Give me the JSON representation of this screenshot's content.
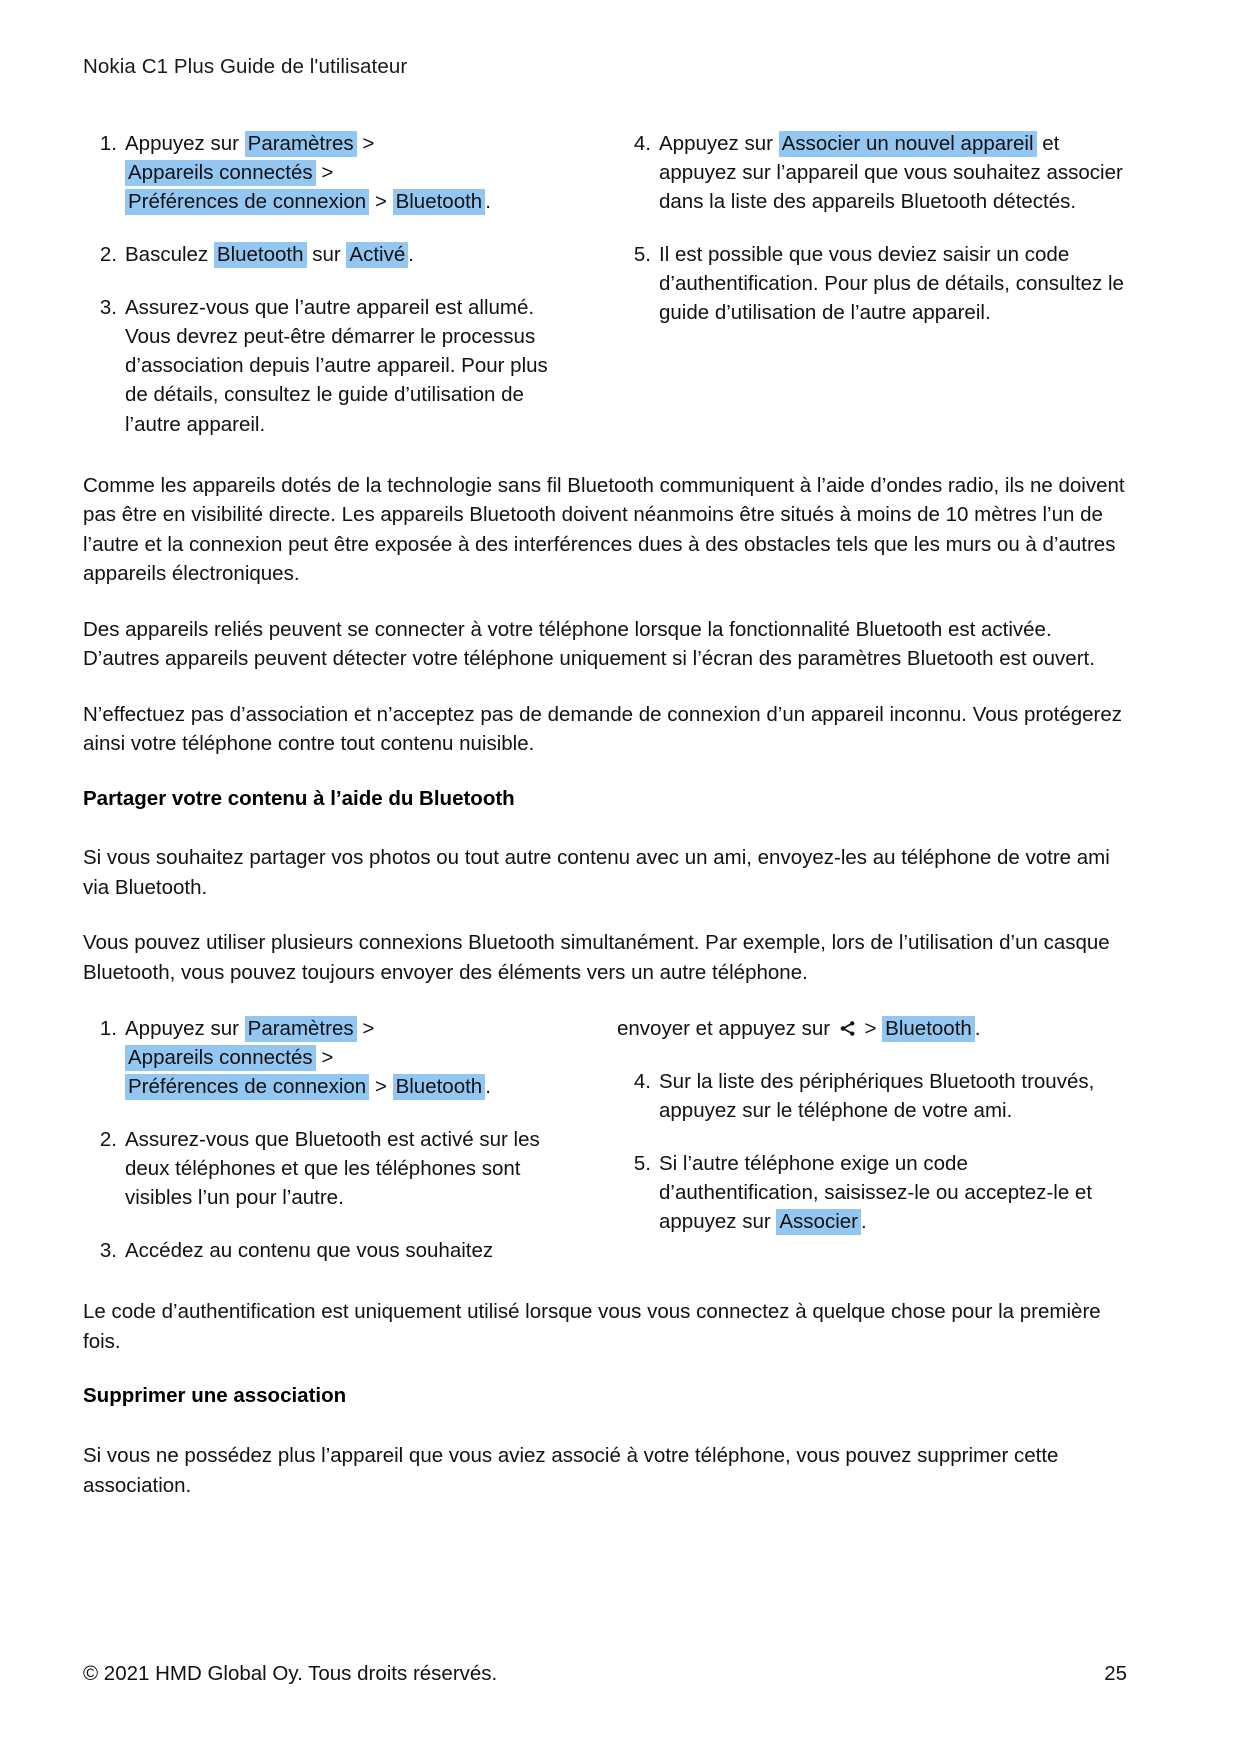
{
  "header": {
    "title": "Nokia C1 Plus Guide de l'utilisateur"
  },
  "section_pairing": {
    "left_steps": [
      {
        "num": "1.",
        "parts": [
          {
            "t": "text",
            "v": "Appuyez sur "
          },
          {
            "t": "hl",
            "v": "Paramètres"
          },
          {
            "t": "text",
            "v": " > "
          },
          {
            "t": "hl",
            "v": "Appareils connectés"
          },
          {
            "t": "text",
            "v": " > "
          },
          {
            "t": "hl",
            "v": "Préférences de connexion"
          },
          {
            "t": "text",
            "v": " > "
          },
          {
            "t": "hl",
            "v": "Bluetooth"
          },
          {
            "t": "text",
            "v": "."
          }
        ]
      },
      {
        "num": "2.",
        "parts": [
          {
            "t": "text",
            "v": "Basculez "
          },
          {
            "t": "hl",
            "v": "Bluetooth"
          },
          {
            "t": "text",
            "v": " sur "
          },
          {
            "t": "hl",
            "v": "Activé"
          },
          {
            "t": "text",
            "v": "."
          }
        ]
      },
      {
        "num": "3.",
        "parts": [
          {
            "t": "text",
            "v": "Assurez-vous que l’autre appareil est allumé. Vous devrez peut-être démarrer le processus d’association depuis l’autre appareil. Pour plus de détails, consultez le guide d’utilisation de l’autre appareil."
          }
        ]
      }
    ],
    "right_steps": [
      {
        "num": "4.",
        "parts": [
          {
            "t": "text",
            "v": "Appuyez sur "
          },
          {
            "t": "hl",
            "v": "Associer un nouvel appareil"
          },
          {
            "t": "text",
            "v": " et appuyez sur l’appareil que vous souhaitez associer dans la liste des appareils Bluetooth détectés."
          }
        ]
      },
      {
        "num": "5.",
        "parts": [
          {
            "t": "text",
            "v": "Il est possible que vous deviez saisir un code d’authentification. Pour plus de détails, consultez le guide d’utilisation de l’autre appareil."
          }
        ]
      }
    ]
  },
  "paragraphs": {
    "p1": "Comme les appareils dotés de la technologie sans fil Bluetooth communiquent à l’aide d’ondes radio, ils ne doivent pas être en visibilité directe. Les appareils Bluetooth doivent néanmoins être situés à moins de 10 mètres l’un de l’autre et la connexion peut être exposée à des interférences dues à des obstacles tels que les murs ou à d’autres appareils électroniques.",
    "p2": "Des appareils reliés peuvent se connecter à votre téléphone lorsque la fonctionnalité Bluetooth est activée. D’autres appareils peuvent détecter votre téléphone uniquement si l’écran des paramètres Bluetooth est ouvert.",
    "p3": "N’effectuez pas d’association et n’acceptez pas de demande de connexion d’un appareil inconnu. Vous protégerez ainsi votre téléphone contre tout contenu nuisible."
  },
  "section_share": {
    "heading": "Partager votre contenu à l’aide du Bluetooth",
    "p1": "Si vous souhaitez partager vos photos ou tout autre contenu avec un ami, envoyez-les au téléphone de votre ami via Bluetooth.",
    "p2": "Vous pouvez utiliser plusieurs connexions Bluetooth simultanément. Par exemple, lors de l’utilisation d’un casque Bluetooth, vous pouvez toujours envoyer des éléments vers un autre téléphone.",
    "left_steps": [
      {
        "num": "1.",
        "parts": [
          {
            "t": "text",
            "v": "Appuyez sur "
          },
          {
            "t": "hl",
            "v": "Paramètres"
          },
          {
            "t": "text",
            "v": " > "
          },
          {
            "t": "hl",
            "v": "Appareils connectés"
          },
          {
            "t": "text",
            "v": " > "
          },
          {
            "t": "hl",
            "v": "Préférences de connexion"
          },
          {
            "t": "text",
            "v": " > "
          },
          {
            "t": "hl",
            "v": "Bluetooth"
          },
          {
            "t": "text",
            "v": "."
          }
        ]
      },
      {
        "num": "2.",
        "parts": [
          {
            "t": "text",
            "v": "Assurez-vous que Bluetooth est activé sur les deux téléphones et que les téléphones sont visibles l’un pour l’autre."
          }
        ]
      },
      {
        "num": "3.",
        "parts": [
          {
            "t": "text",
            "v": "Accédez au contenu que vous souhaitez"
          }
        ]
      }
    ],
    "right_continuation": [
      {
        "t": "text",
        "v": "envoyer et appuyez sur "
      },
      {
        "t": "icon",
        "v": "share-icon"
      },
      {
        "t": "text",
        "v": " > "
      },
      {
        "t": "hl",
        "v": "Bluetooth"
      },
      {
        "t": "text",
        "v": "."
      }
    ],
    "right_steps": [
      {
        "num": "4.",
        "parts": [
          {
            "t": "text",
            "v": "Sur la liste des périphériques Bluetooth trouvés, appuyez sur le téléphone de votre ami."
          }
        ]
      },
      {
        "num": "5.",
        "parts": [
          {
            "t": "text",
            "v": "Si l’autre téléphone exige un code d’authentification, saisissez-le ou acceptez-le et appuyez sur "
          },
          {
            "t": "hl",
            "v": "Associer"
          },
          {
            "t": "text",
            "v": "."
          }
        ]
      }
    ],
    "p3": "Le code d’authentification est uniquement utilisé lorsque vous vous connectez à quelque chose pour la première fois."
  },
  "section_remove": {
    "heading": "Supprimer une association",
    "p1": "Si vous ne possédez plus l’appareil que vous aviez associé à votre téléphone, vous pouvez supprimer cette association."
  },
  "footer": {
    "copyright": "© 2021 HMD Global Oy. Tous droits réservés.",
    "page_number": "25"
  },
  "colors": {
    "highlight": "#94c6f2",
    "text": "#121212"
  }
}
